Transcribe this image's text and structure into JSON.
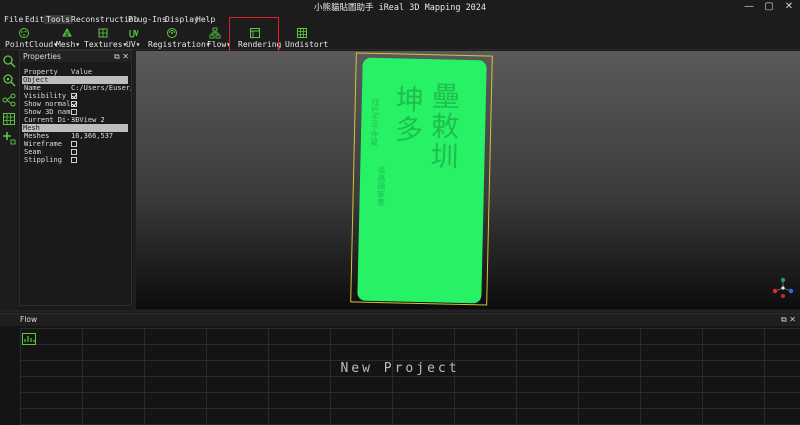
{
  "window": {
    "title": "小熊貓貼圖助手 iReal 3D Mapping 2024",
    "controls": [
      "—",
      "▢",
      "✕"
    ]
  },
  "menu": [
    "File",
    "Edit",
    "Tools",
    "Reconstruction",
    "Plug-Ins",
    "Display",
    "Help"
  ],
  "menu_active": "Tools",
  "toolbar": {
    "items": [
      {
        "label": "PointCloud",
        "icon": "point-cloud-icon"
      },
      {
        "label": "Mesh",
        "icon": "mesh-icon"
      },
      {
        "label": "Textures",
        "icon": "textures-icon"
      },
      {
        "label": "UV",
        "icon": "uv-icon"
      },
      {
        "label": "Registration",
        "icon": "registration-icon"
      },
      {
        "label": "Flow",
        "icon": "flow-icon"
      },
      {
        "label": "Rendering",
        "icon": "rendering-icon"
      },
      {
        "label": "Undistort",
        "icon": "undistort-icon"
      }
    ],
    "dropdown_marker": "▾",
    "highlighted": "Rendering",
    "accent": "#5cc840",
    "highlight_color": "#e02020"
  },
  "properties": {
    "title": "Properties",
    "header": {
      "key": "Property",
      "value": "Value"
    },
    "section_object": "Object",
    "name_key": "Name",
    "name_value": "C:/Users/Euser/",
    "visibility_key": "Visibility",
    "show_normals_key": "Show normals",
    "show_3d_name_key": "Show 3D name",
    "current_key": "Current Di···",
    "current_value": "3DView 2",
    "section_mesh": "Mesh",
    "meshes_key": "Meshes",
    "meshes_value": "16,366,537",
    "wireframe_key": "Wireframe",
    "seam_key": "Seam",
    "stippling_key": "Stippling",
    "checks": {
      "visibility": true,
      "show_normals": true,
      "show_3d_name": false,
      "wireframe": false,
      "seam": false,
      "stippling": false
    }
  },
  "viewport": {
    "model_color": "#27f266",
    "bbox_color": "#d8c23a",
    "carved_big_text": "壘敕圳 坤多",
    "carved_small_text": "戍巳壬子仲夏吳昌碩篆書"
  },
  "flow_panel": {
    "title": "Flow",
    "placeholder": "New Project"
  }
}
